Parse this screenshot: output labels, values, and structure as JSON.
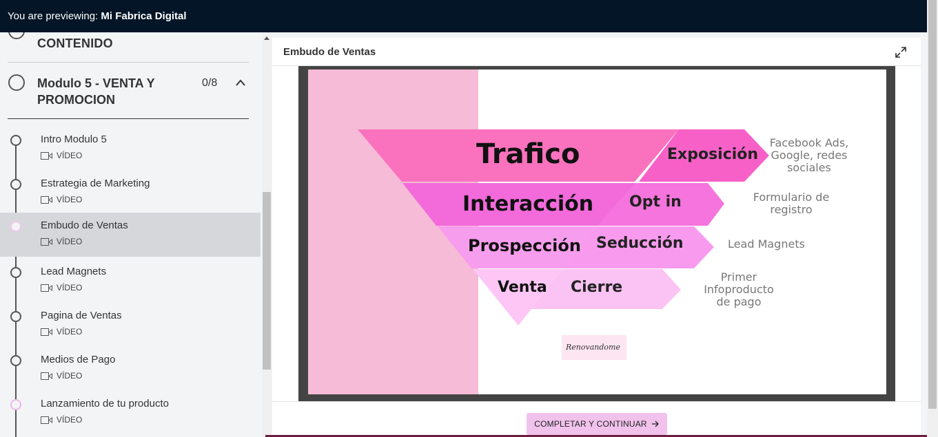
{
  "topbar": {
    "prefix": "You are previewing: ",
    "school": "Mi Fabrica Digital"
  },
  "sidebar": {
    "prev_section_title": "CONTENIDO",
    "module": {
      "title": "Modulo 5 - VENTA Y PROMOCION",
      "count": "0/8"
    },
    "lessons": [
      {
        "title": "Intro Modulo 5",
        "type": "VÍDEO"
      },
      {
        "title": "Estrategia de Marketing",
        "type": "VÍDEO"
      },
      {
        "title": "Embudo de Ventas",
        "type": "VÍDEO"
      },
      {
        "title": "Lead Magnets",
        "type": "VÍDEO"
      },
      {
        "title": "Pagina de Ventas",
        "type": "VÍDEO"
      },
      {
        "title": "Medios de Pago",
        "type": "VÍDEO"
      },
      {
        "title": "Lanzamiento de tu producto",
        "type": "VÍDEO"
      }
    ]
  },
  "content": {
    "title": "Embudo de Ventas",
    "slide": {
      "funnel": [
        "Trafico",
        "Interacción",
        "Prospección",
        "Venta"
      ],
      "arrows": [
        "Exposición",
        "Opt in",
        "Seducción",
        "Cierre"
      ],
      "notes": [
        [
          "Facebook Ads,",
          "Google, redes",
          "sociales"
        ],
        [
          "Formulario de",
          "registro"
        ],
        [
          "Lead Magnets"
        ],
        [
          "Primer",
          "Infoproducto",
          "de pago"
        ]
      ],
      "signature": "Renovandome"
    },
    "complete_button": "COMPLETAR Y CONTINUAR"
  },
  "colors": {
    "topbar": "#031526",
    "active_lesson": "#d6d7db",
    "button": "#f1c2ec",
    "pink_band": "#f6bbd6"
  }
}
